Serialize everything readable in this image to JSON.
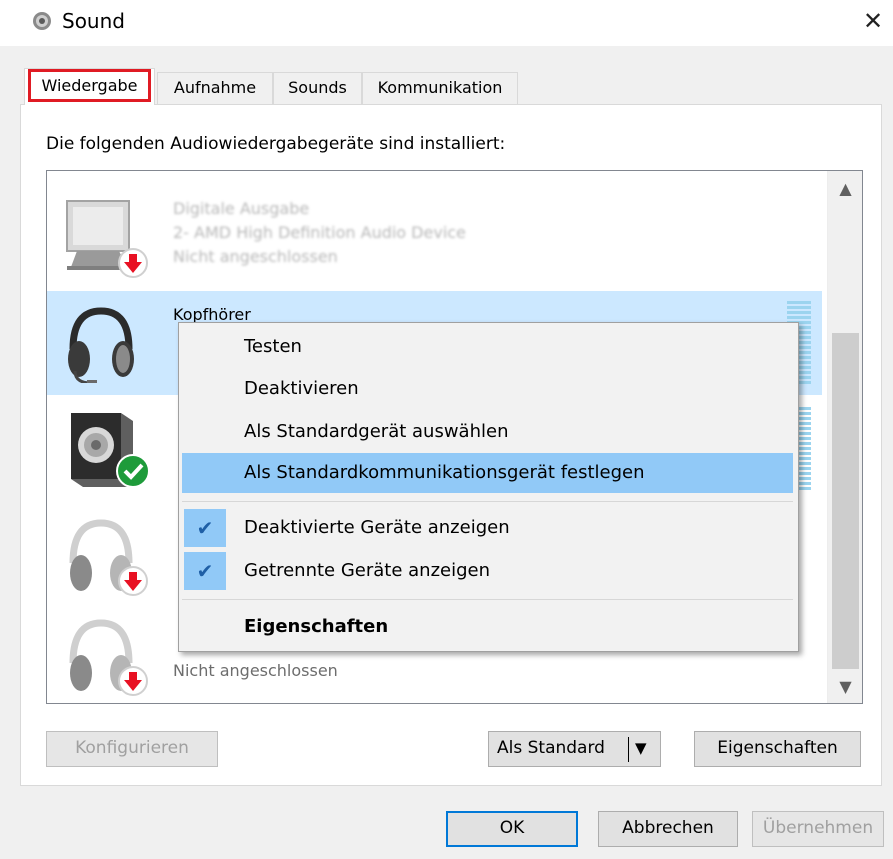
{
  "window": {
    "title": "Sound",
    "close_symbol": "✕"
  },
  "tabs": [
    {
      "label": "Wiedergabe",
      "active": true
    },
    {
      "label": "Aufnahme",
      "active": false
    },
    {
      "label": "Sounds",
      "active": false
    },
    {
      "label": "Kommunikation",
      "active": false
    }
  ],
  "panel": {
    "instructions": "Die folgenden Audiowiedergabegeräte sind installiert:"
  },
  "devices": [
    {
      "name": "Digitale Ausgabe",
      "description": "2- AMD High Definition Audio Device",
      "status": "Nicht angeschlossen",
      "icon": "monitor-icon",
      "badge": "disconnected-badge"
    },
    {
      "name": "Kopfhörer",
      "icon": "headset-icon",
      "selected": true
    },
    {
      "icon": "speaker-icon",
      "badge": "default-checkmark-badge"
    },
    {
      "icon": "headphones-icon",
      "badge": "disconnected-badge"
    },
    {
      "status": "Nicht angeschlossen",
      "icon": "headphones-icon",
      "badge": "disconnected-badge"
    }
  ],
  "scrollbar": {
    "up_arrow": "▲",
    "down_arrow": "▼"
  },
  "buttons": {
    "configure": "Konfigurieren",
    "set_default": "Als Standard",
    "set_default_arrow": "▼",
    "properties": "Eigenschaften",
    "ok": "OK",
    "cancel": "Abbrechen",
    "apply": "Übernehmen"
  },
  "context_menu": {
    "items": [
      {
        "label": "Testen"
      },
      {
        "label": "Deaktivieren"
      },
      {
        "label": "Als Standardgerät auswählen"
      },
      {
        "label": "Als Standardkommunikationsgerät festlegen",
        "highlighted": true
      },
      {
        "label": "Deaktivierte Geräte anzeigen",
        "checked": true
      },
      {
        "label": "Getrennte Geräte anzeigen",
        "checked": true
      },
      {
        "label": "Eigenschaften",
        "bold": true
      }
    ],
    "check_symbol": "✔"
  },
  "colors": {
    "selection": "#cce8ff",
    "menu_highlight": "#91c9f7",
    "tab_highlight_border": "#e01b24",
    "default_button_border": "#0078d7"
  }
}
